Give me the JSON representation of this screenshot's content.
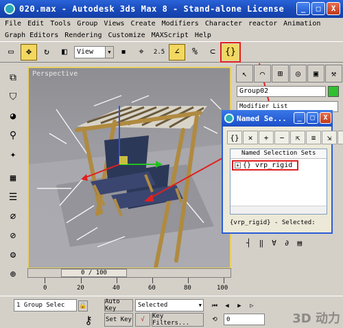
{
  "window": {
    "title": "020.max - Autodesk 3ds Max 8 - Stand-alone License",
    "controls": [
      "_",
      "□",
      "X"
    ]
  },
  "menu": {
    "row1": [
      "File",
      "Edit",
      "Tools",
      "Group",
      "Views",
      "Create",
      "Modifiers",
      "Character",
      "reactor",
      "Animation"
    ],
    "row2": [
      "Graph Editors",
      "Rendering",
      "Customize",
      "MAXScript",
      "Help"
    ]
  },
  "toolbar": {
    "view_select": "View",
    "spinner_label": "2.5"
  },
  "viewport": {
    "label": "Perspective"
  },
  "timeline": {
    "slider": "0 / 100",
    "ticks": [
      "0",
      "20",
      "40",
      "60",
      "80",
      "100"
    ]
  },
  "status": {
    "selection": "1 Group Selec",
    "auto_key": "Auto Key",
    "set_key": "Set Key",
    "key_mode": "Selected",
    "key_filters": "Key Filters...",
    "frame": "0"
  },
  "command_panel": {
    "object_name": "Group02",
    "modifier_list": "Modifier List",
    "color": "#30c030"
  },
  "dialog": {
    "title": "Named Se...",
    "column_header": "Named Selection Sets",
    "item": "{} vrp_rigid",
    "status": "{vrp_rigid} - Selected:"
  },
  "watermark": "3D 动力"
}
